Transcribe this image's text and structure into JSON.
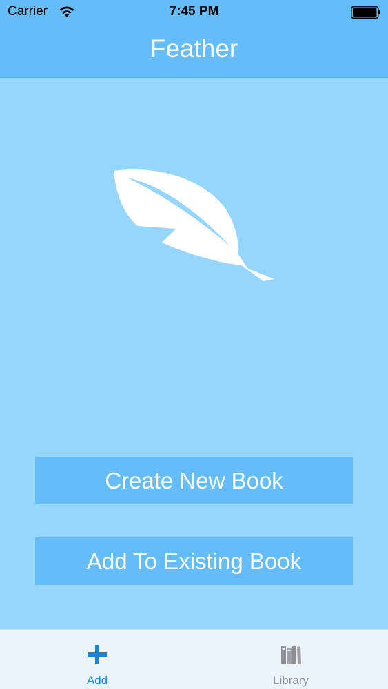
{
  "status_bar": {
    "carrier": "Carrier",
    "time": "7:45 PM"
  },
  "nav": {
    "title": "Feather"
  },
  "main": {
    "logo_icon": "feather-icon",
    "create_button_label": "Create New Book",
    "add_button_label": "Add To Existing Book"
  },
  "tab_bar": {
    "tabs": [
      {
        "label": "Add",
        "icon": "plus-icon",
        "selected": true
      },
      {
        "label": "Library",
        "icon": "books-icon",
        "selected": false
      }
    ]
  },
  "colors": {
    "background": "#96d6fc",
    "accent": "#64bdf9",
    "tab_selected": "#1a83d6",
    "tab_unselected": "#8e8e93"
  }
}
